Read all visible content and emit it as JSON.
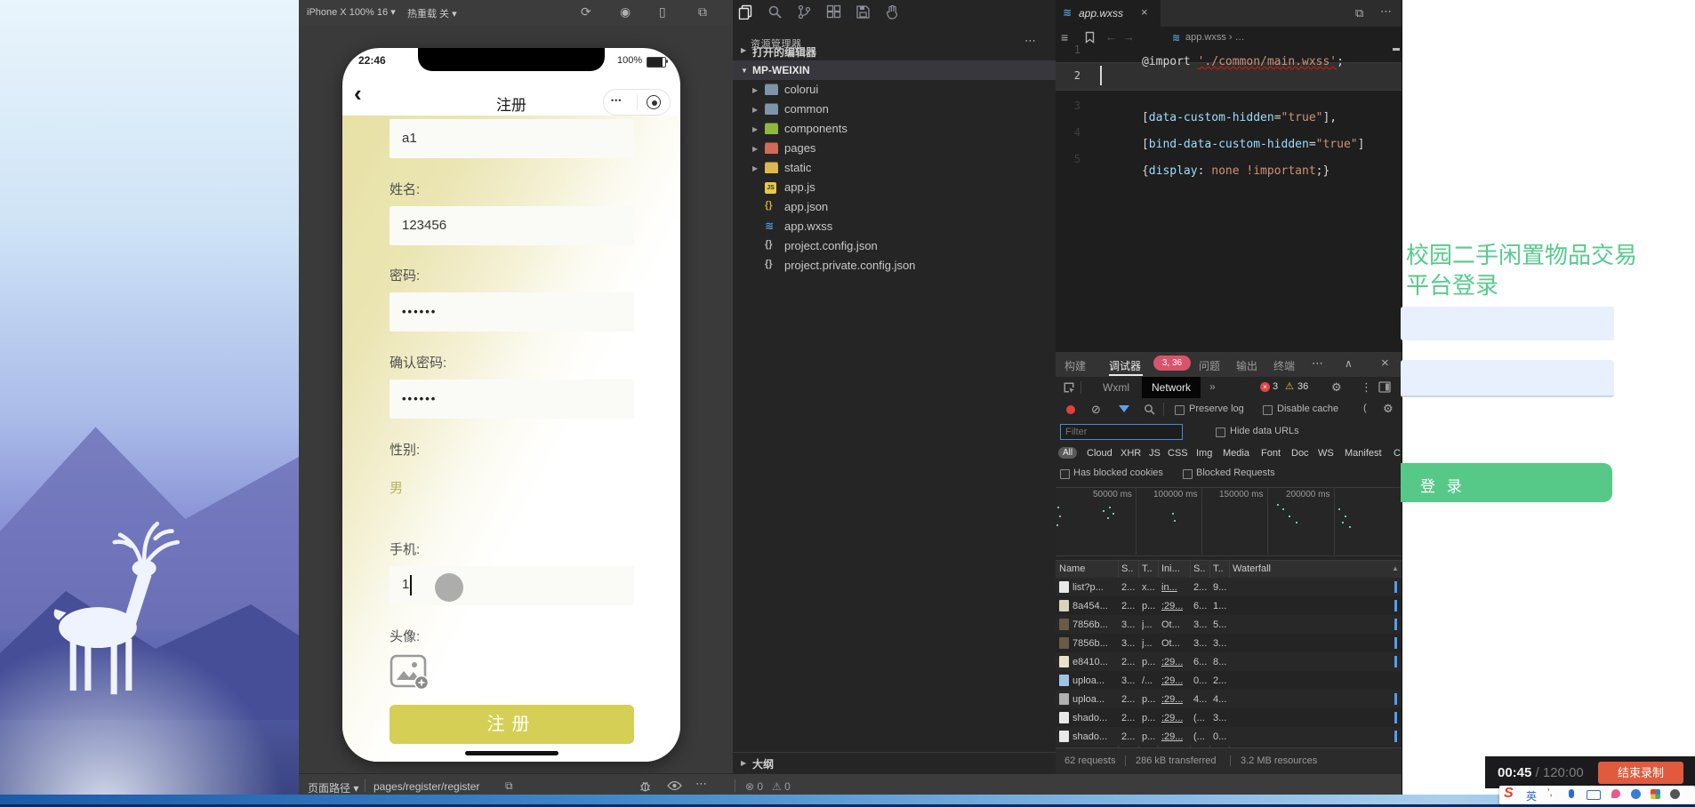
{
  "icons": {
    "refresh": "⟳",
    "compile": "◉",
    "device": "▯",
    "panel": "⧉",
    "more": "⋯",
    "ellipsis": "…",
    "caret_down": "▾",
    "chevron_back": "‹",
    "breadcrumb_sep": "›",
    "block": "⊘",
    "gear": "⚙",
    "kebab": "⋮",
    "warning": "⚠",
    "error_circle": "⊗",
    "sort_up": "▲",
    "collapse_up": "∧",
    "close": "×",
    "expand": "▶",
    "expanded": "▼",
    "menu": "≡",
    "back": "←",
    "forward": "→",
    "more_tabs": "»",
    "dots": "•••",
    "wxss": "≋",
    "copy": "⧉",
    "pipe": "|"
  },
  "colors": {
    "accent_yellow": "#d5cf55",
    "devtools_blue": "#4da1f5",
    "page_green": "#57c989",
    "record_red": "#e0413e",
    "badge_red": "#d9536b",
    "stop_orange": "#e25a3d",
    "gender_olive": "#b9b160"
  },
  "sim": {
    "toolbar": {
      "device": "iPhone X 100% 16",
      "hot_reload": "热重载 关"
    },
    "bottom": {
      "path_label": "页面路径",
      "path": "pages/register/register",
      "errors": "0",
      "warnings": "0"
    }
  },
  "phone": {
    "time": "22:46",
    "battery": "100%",
    "nav_title": "注册",
    "form": {
      "account_value": "a1",
      "name_label": "姓名:",
      "name_value": "123456",
      "pwd_label": "密码:",
      "pwd_value": "••••••",
      "confirm_label": "确认密码:",
      "confirm_value": "••••••",
      "gender_label": "性别:",
      "gender_value": "男",
      "mobile_label": "手机:",
      "mobile_value": "1",
      "avatar_label": "头像:",
      "submit": "注册"
    }
  },
  "explorer": {
    "title": "资源管理器",
    "open_editors": "打开的编辑器",
    "root": "MP-WEIXIN",
    "outline": "大纲",
    "items": [
      {
        "label": "colorui"
      },
      {
        "label": "common"
      },
      {
        "label": "components"
      },
      {
        "label": "pages"
      },
      {
        "label": "static"
      },
      {
        "label": "app.js"
      },
      {
        "label": "app.json"
      },
      {
        "label": "app.wxss"
      },
      {
        "label": "project.config.json"
      },
      {
        "label": "project.private.config.json"
      }
    ]
  },
  "editor": {
    "tab": "app.wxss",
    "crumb_file": "app.wxss",
    "nums": [
      "1",
      "2",
      "3",
      "4",
      "5"
    ],
    "l1": {
      "kw": "@import ",
      "str": "'./common/main.wxss'",
      "end": ";"
    },
    "l3": {
      "p1": "[",
      "attr": "data-custom-hidden",
      "p2": "=",
      "str": "\"true\"",
      "p3": "],"
    },
    "l4": {
      "p1": "[",
      "attr": "bind-data-custom-hidden",
      "p2": "=",
      "str": "\"true\"",
      "p3": "]"
    },
    "l5": {
      "p1": "{",
      "prop": "display",
      "p2": ": ",
      "v1": "none",
      "v2": " !important",
      "p3": ";}"
    }
  },
  "dbg": {
    "tabs": [
      "构建",
      "调试器",
      "问题",
      "输出",
      "终端"
    ],
    "badge": "3, 36",
    "wxml": "Wxml",
    "network": "Network",
    "errors": "3",
    "warnings": "36",
    "preserve": "Preserve log",
    "cache": "Disable cache",
    "paren": "(",
    "filter_ph": "Filter",
    "hide_urls": "Hide data URLs",
    "chips": [
      "All",
      "Cloud",
      "XHR",
      "JS",
      "CSS",
      "Img",
      "Media",
      "Font",
      "Doc",
      "WS",
      "Manifest",
      "C"
    ],
    "cookies": "Has blocked cookies",
    "blocked": "Blocked Requests",
    "ticks": [
      "50000 ms",
      "100000 ms",
      "150000 ms",
      "200000 ms"
    ],
    "cols": [
      "Name",
      "S..",
      "T..",
      "Ini...",
      "S..",
      "T..",
      "Waterfall"
    ],
    "rows": [
      {
        "name": "list?p...",
        "c1": "2...",
        "c2": "x...",
        "c3": "in...",
        "c4": "2...",
        "c5": "9..."
      },
      {
        "name": "8a454...",
        "c1": "2...",
        "c2": "p...",
        "c3": ":29...",
        "c4": "6...",
        "c5": "1..."
      },
      {
        "name": "7856b...",
        "c1": "3...",
        "c2": "j...",
        "c3": "Ot...",
        "c4": "3...",
        "c5": "5..."
      },
      {
        "name": "7856b...",
        "c1": "3...",
        "c2": "j...",
        "c3": "Ot...",
        "c4": "3...",
        "c5": "3..."
      },
      {
        "name": "e8410...",
        "c1": "2...",
        "c2": "p...",
        "c3": ":29...",
        "c4": "6...",
        "c5": "8..."
      },
      {
        "name": "uploa...",
        "c1": "3...",
        "c2": "/...",
        "c3": ":29...",
        "c4": "0...",
        "c5": "2..."
      },
      {
        "name": "uploa...",
        "c1": "2...",
        "c2": "p...",
        "c3": ":29...",
        "c4": "4...",
        "c5": "4..."
      },
      {
        "name": "shado...",
        "c1": "2...",
        "c2": "p...",
        "c3": ":29...",
        "c4": "(...",
        "c5": "3..."
      },
      {
        "name": "shado...",
        "c1": "2...",
        "c2": "p...",
        "c3": ":29...",
        "c4": "(...",
        "c5": "0..."
      }
    ],
    "sum1": "62 requests",
    "sum2": "286 kB transferred",
    "sum3": "3.2 MB resources"
  },
  "bg_page": {
    "title": "校园二手闲置物品交易平台登录",
    "login": "登 录"
  },
  "recorder": {
    "elapsed": "00:45",
    "total": " / 120:00",
    "stop": "结束录制"
  },
  "input_bar": {
    "logo": "S",
    "lang": "英",
    "punct": "’,"
  }
}
